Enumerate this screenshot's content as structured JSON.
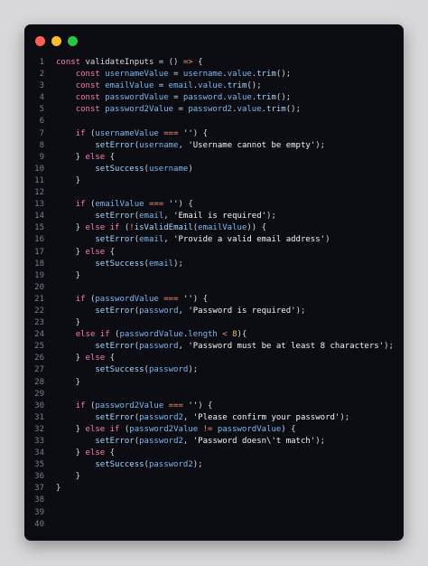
{
  "window": {
    "controls": [
      {
        "name": "close",
        "color": "#ff5f57"
      },
      {
        "name": "minimize",
        "color": "#febc2e"
      },
      {
        "name": "maximize",
        "color": "#28c840"
      }
    ]
  },
  "code": {
    "lines": [
      {
        "n": "1",
        "tokens": [
          [
            "kw",
            "const "
          ],
          [
            "pl",
            "validateInputs = () "
          ],
          [
            "op",
            "=>"
          ],
          [
            "pl",
            " {"
          ]
        ]
      },
      {
        "n": "2",
        "tokens": [
          [
            "pl",
            "    "
          ],
          [
            "kw",
            "const "
          ],
          [
            "id",
            "usernameValue"
          ],
          [
            "pl",
            " = "
          ],
          [
            "id",
            "username"
          ],
          [
            "pl",
            "."
          ],
          [
            "id",
            "value"
          ],
          [
            "pl",
            "."
          ],
          [
            "fn",
            "trim"
          ],
          [
            "pl",
            "();"
          ]
        ]
      },
      {
        "n": "3",
        "tokens": [
          [
            "pl",
            "    "
          ],
          [
            "kw",
            "const "
          ],
          [
            "id",
            "emailValue"
          ],
          [
            "pl",
            " = "
          ],
          [
            "id",
            "email"
          ],
          [
            "pl",
            "."
          ],
          [
            "id",
            "value"
          ],
          [
            "pl",
            "."
          ],
          [
            "fn",
            "trim"
          ],
          [
            "pl",
            "();"
          ]
        ]
      },
      {
        "n": "4",
        "tokens": [
          [
            "pl",
            "    "
          ],
          [
            "kw",
            "const "
          ],
          [
            "id",
            "passwordValue"
          ],
          [
            "pl",
            " = "
          ],
          [
            "id",
            "password"
          ],
          [
            "pl",
            "."
          ],
          [
            "id",
            "value"
          ],
          [
            "pl",
            "."
          ],
          [
            "fn",
            "trim"
          ],
          [
            "pl",
            "();"
          ]
        ]
      },
      {
        "n": "5",
        "tokens": [
          [
            "pl",
            "    "
          ],
          [
            "kw",
            "const "
          ],
          [
            "id",
            "password2Value"
          ],
          [
            "pl",
            " = "
          ],
          [
            "id",
            "password2"
          ],
          [
            "pl",
            "."
          ],
          [
            "id",
            "value"
          ],
          [
            "pl",
            "."
          ],
          [
            "fn",
            "trim"
          ],
          [
            "pl",
            "();"
          ]
        ]
      },
      {
        "n": "6",
        "tokens": [
          [
            "pl",
            ""
          ]
        ]
      },
      {
        "n": "7",
        "tokens": [
          [
            "pl",
            "    "
          ],
          [
            "kw",
            "if"
          ],
          [
            "pl",
            " ("
          ],
          [
            "id",
            "usernameValue"
          ],
          [
            "pl",
            " "
          ],
          [
            "op",
            "==="
          ],
          [
            "pl",
            " "
          ],
          [
            "str",
            "''"
          ],
          [
            "pl",
            ") {"
          ]
        ]
      },
      {
        "n": "8",
        "tokens": [
          [
            "pl",
            "        "
          ],
          [
            "fn",
            "setError"
          ],
          [
            "pl",
            "("
          ],
          [
            "id",
            "username"
          ],
          [
            "pl",
            ", "
          ],
          [
            "str",
            "'Username cannot be empty'"
          ],
          [
            "pl",
            ");"
          ]
        ]
      },
      {
        "n": "9",
        "tokens": [
          [
            "pl",
            "    } "
          ],
          [
            "kw",
            "else"
          ],
          [
            "pl",
            " {"
          ]
        ]
      },
      {
        "n": "10",
        "tokens": [
          [
            "pl",
            "        "
          ],
          [
            "fn",
            "setSuccess"
          ],
          [
            "pl",
            "("
          ],
          [
            "id",
            "username"
          ],
          [
            "pl",
            ")"
          ]
        ]
      },
      {
        "n": "11",
        "tokens": [
          [
            "pl",
            "    }"
          ]
        ]
      },
      {
        "n": "12",
        "tokens": [
          [
            "pl",
            ""
          ]
        ]
      },
      {
        "n": "13",
        "tokens": [
          [
            "pl",
            "    "
          ],
          [
            "kw",
            "if"
          ],
          [
            "pl",
            " ("
          ],
          [
            "id",
            "emailValue"
          ],
          [
            "pl",
            " "
          ],
          [
            "op",
            "==="
          ],
          [
            "pl",
            " "
          ],
          [
            "str",
            "''"
          ],
          [
            "pl",
            ") {"
          ]
        ]
      },
      {
        "n": "14",
        "tokens": [
          [
            "pl",
            "        "
          ],
          [
            "fn",
            "setError"
          ],
          [
            "pl",
            "("
          ],
          [
            "id",
            "email"
          ],
          [
            "pl",
            ", "
          ],
          [
            "str",
            "'Email is required'"
          ],
          [
            "pl",
            ");"
          ]
        ]
      },
      {
        "n": "15",
        "tokens": [
          [
            "pl",
            "    } "
          ],
          [
            "kw",
            "else if"
          ],
          [
            "pl",
            " ("
          ],
          [
            "op",
            "!"
          ],
          [
            "fn",
            "isValidEmail"
          ],
          [
            "pl",
            "("
          ],
          [
            "id",
            "emailValue"
          ],
          [
            "pl",
            ")) {"
          ]
        ]
      },
      {
        "n": "16",
        "tokens": [
          [
            "pl",
            "        "
          ],
          [
            "fn",
            "setError"
          ],
          [
            "pl",
            "("
          ],
          [
            "id",
            "email"
          ],
          [
            "pl",
            ", "
          ],
          [
            "str",
            "'Provide a valid email address'"
          ],
          [
            "pl",
            ")"
          ]
        ]
      },
      {
        "n": "17",
        "tokens": [
          [
            "pl",
            "    } "
          ],
          [
            "kw",
            "else"
          ],
          [
            "pl",
            " {"
          ]
        ]
      },
      {
        "n": "18",
        "tokens": [
          [
            "pl",
            "        "
          ],
          [
            "fn",
            "setSuccess"
          ],
          [
            "pl",
            "("
          ],
          [
            "id",
            "email"
          ],
          [
            "pl",
            ");"
          ]
        ]
      },
      {
        "n": "19",
        "tokens": [
          [
            "pl",
            "    }"
          ]
        ]
      },
      {
        "n": "20",
        "tokens": [
          [
            "pl",
            ""
          ]
        ]
      },
      {
        "n": "21",
        "tokens": [
          [
            "pl",
            "    "
          ],
          [
            "kw",
            "if"
          ],
          [
            "pl",
            " ("
          ],
          [
            "id",
            "passwordValue"
          ],
          [
            "pl",
            " "
          ],
          [
            "op",
            "==="
          ],
          [
            "pl",
            " "
          ],
          [
            "str",
            "''"
          ],
          [
            "pl",
            ") {"
          ]
        ]
      },
      {
        "n": "22",
        "tokens": [
          [
            "pl",
            "        "
          ],
          [
            "fn",
            "setError"
          ],
          [
            "pl",
            "("
          ],
          [
            "id",
            "password"
          ],
          [
            "pl",
            ", "
          ],
          [
            "str",
            "'Password is required'"
          ],
          [
            "pl",
            ");"
          ]
        ]
      },
      {
        "n": "23",
        "tokens": [
          [
            "pl",
            "    }"
          ]
        ]
      },
      {
        "n": "24",
        "tokens": [
          [
            "pl",
            "    "
          ],
          [
            "kw",
            "else if"
          ],
          [
            "pl",
            " ("
          ],
          [
            "id",
            "passwordValue"
          ],
          [
            "pl",
            "."
          ],
          [
            "id",
            "length"
          ],
          [
            "pl",
            " "
          ],
          [
            "op",
            "<"
          ],
          [
            "pl",
            " "
          ],
          [
            "num",
            "8"
          ],
          [
            "pl",
            "){"
          ]
        ]
      },
      {
        "n": "25",
        "tokens": [
          [
            "pl",
            "        "
          ],
          [
            "fn",
            "setError"
          ],
          [
            "pl",
            "("
          ],
          [
            "id",
            "password"
          ],
          [
            "pl",
            ", "
          ],
          [
            "str",
            "'Password must be at least 8 characters'"
          ],
          [
            "pl",
            ");"
          ]
        ]
      },
      {
        "n": "26",
        "tokens": [
          [
            "pl",
            "    } "
          ],
          [
            "kw",
            "else"
          ],
          [
            "pl",
            " {"
          ]
        ]
      },
      {
        "n": "27",
        "tokens": [
          [
            "pl",
            "        "
          ],
          [
            "fn",
            "setSuccess"
          ],
          [
            "pl",
            "("
          ],
          [
            "id",
            "password"
          ],
          [
            "pl",
            ");"
          ]
        ]
      },
      {
        "n": "28",
        "tokens": [
          [
            "pl",
            "    }"
          ]
        ]
      },
      {
        "n": "29",
        "tokens": [
          [
            "pl",
            ""
          ]
        ]
      },
      {
        "n": "30",
        "tokens": [
          [
            "pl",
            "    "
          ],
          [
            "kw",
            "if"
          ],
          [
            "pl",
            " ("
          ],
          [
            "id",
            "password2Value"
          ],
          [
            "pl",
            " "
          ],
          [
            "op",
            "==="
          ],
          [
            "pl",
            " "
          ],
          [
            "str",
            "''"
          ],
          [
            "pl",
            ") {"
          ]
        ]
      },
      {
        "n": "31",
        "tokens": [
          [
            "pl",
            "        "
          ],
          [
            "fn",
            "setError"
          ],
          [
            "pl",
            "("
          ],
          [
            "id",
            "password2"
          ],
          [
            "pl",
            ", "
          ],
          [
            "str",
            "'Please confirm your password'"
          ],
          [
            "pl",
            ");"
          ]
        ]
      },
      {
        "n": "32",
        "tokens": [
          [
            "pl",
            "    } "
          ],
          [
            "kw",
            "else if"
          ],
          [
            "pl",
            " ("
          ],
          [
            "id",
            "password2Value"
          ],
          [
            "pl",
            " "
          ],
          [
            "op",
            "!="
          ],
          [
            "pl",
            " "
          ],
          [
            "id",
            "passwordValue"
          ],
          [
            "pl",
            ") {"
          ]
        ]
      },
      {
        "n": "33",
        "tokens": [
          [
            "pl",
            "        "
          ],
          [
            "fn",
            "setError"
          ],
          [
            "pl",
            "("
          ],
          [
            "id",
            "password2"
          ],
          [
            "pl",
            ", "
          ],
          [
            "str",
            "'Password doesn\\'t match'"
          ],
          [
            "pl",
            ");"
          ]
        ]
      },
      {
        "n": "34",
        "tokens": [
          [
            "pl",
            "    } "
          ],
          [
            "kw",
            "else"
          ],
          [
            "pl",
            " {"
          ]
        ]
      },
      {
        "n": "35",
        "tokens": [
          [
            "pl",
            "        "
          ],
          [
            "fn",
            "setSuccess"
          ],
          [
            "pl",
            "("
          ],
          [
            "id",
            "password2"
          ],
          [
            "pl",
            ");"
          ]
        ]
      },
      {
        "n": "36",
        "tokens": [
          [
            "pl",
            "    }"
          ]
        ]
      },
      {
        "n": "37",
        "tokens": [
          [
            "pl",
            "}"
          ]
        ]
      },
      {
        "n": "38",
        "tokens": [
          [
            "pl",
            ""
          ]
        ]
      },
      {
        "n": "39",
        "tokens": [
          [
            "pl",
            ""
          ]
        ]
      },
      {
        "n": "40",
        "tokens": [
          [
            "pl",
            ""
          ]
        ]
      }
    ]
  }
}
